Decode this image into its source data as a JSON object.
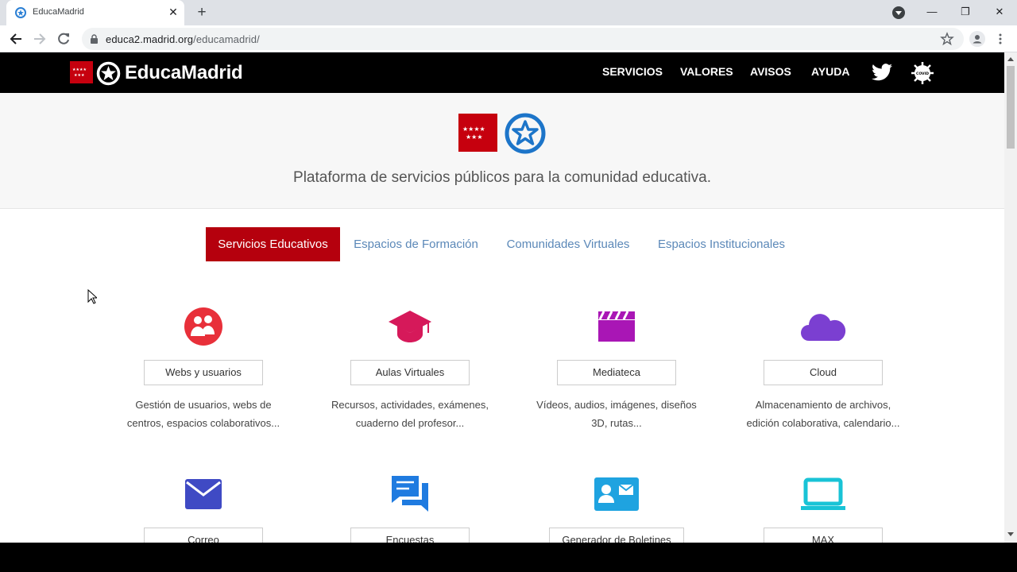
{
  "browser": {
    "tab_title": "EducaMadrid",
    "tab_close": "✕",
    "new_tab": "+",
    "url_host": "educa2.madrid.org",
    "url_path": "/educamadrid/",
    "win_minimize": "—",
    "win_restore": "❐",
    "win_close": "✕"
  },
  "site": {
    "brand": "EducaMadrid",
    "nav": [
      "SERVICIOS",
      "VALORES",
      "AVISOS",
      "AYUDA"
    ],
    "covid_label": "COVID",
    "tagline": "Plataforma de servicios públicos para la comunidad educativa."
  },
  "tabs": [
    {
      "label": "Servicios Educativos",
      "active": true
    },
    {
      "label": "Espacios de Formación",
      "active": false
    },
    {
      "label": "Comunidades Virtuales",
      "active": false
    },
    {
      "label": "Espacios Institucionales",
      "active": false
    }
  ],
  "services": [
    {
      "label": "Webs y usuarios",
      "icon": "users-group-icon",
      "color": "#e8303a",
      "desc1": "Gestión de usuarios, webs de",
      "desc2": "centros, espacios colaborativos..."
    },
    {
      "label": "Aulas Virtuales",
      "icon": "graduation-cap-icon",
      "color": "#d6195a",
      "desc1": "Recursos, actividades, exámenes,",
      "desc2": "cuaderno del profesor..."
    },
    {
      "label": "Mediateca",
      "icon": "clapperboard-icon",
      "color": "#a916b5",
      "desc1": "Vídeos, audios, imágenes, diseños",
      "desc2": "3D, rutas..."
    },
    {
      "label": "Cloud",
      "icon": "cloud-icon",
      "color": "#7b3fd1",
      "desc1": "Almacenamiento de archivos,",
      "desc2": "edición colaborativa, calendario..."
    },
    {
      "label": "Correo",
      "icon": "envelope-icon",
      "color": "#3f4ac4"
    },
    {
      "label": "Encuestas",
      "icon": "chat-bubbles-icon",
      "color": "#1f7be0"
    },
    {
      "label": "Generador de Boletines",
      "icon": "contact-card-icon",
      "color": "#1fa3e0"
    },
    {
      "label": "MAX",
      "icon": "laptop-icon",
      "color": "#19c3d6"
    }
  ]
}
